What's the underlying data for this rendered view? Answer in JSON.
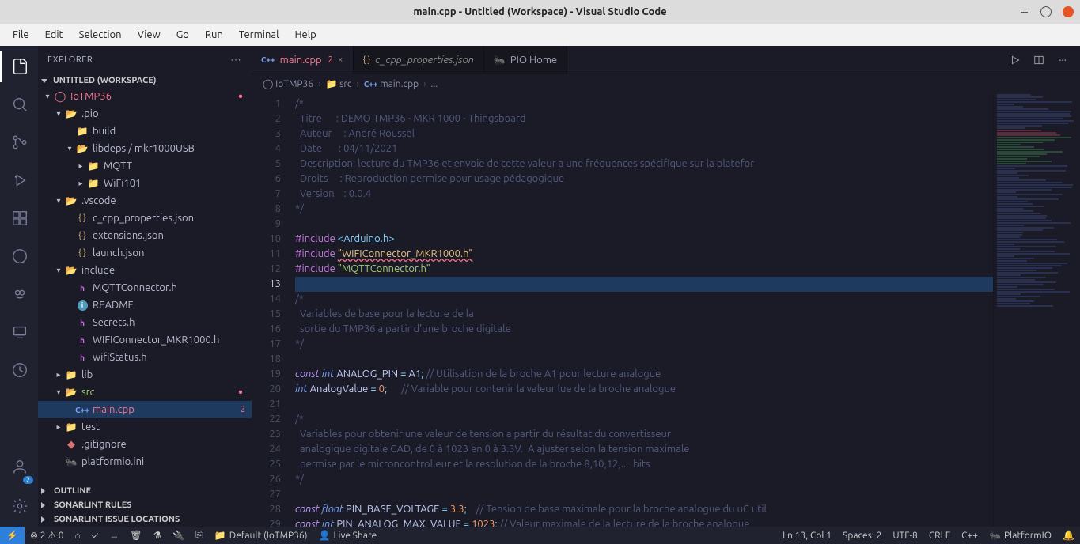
{
  "window": {
    "title": "main.cpp - Untitled (Workspace) - Visual Studio Code"
  },
  "menu": [
    "File",
    "Edit",
    "Selection",
    "View",
    "Go",
    "Run",
    "Terminal",
    "Help"
  ],
  "explorer": {
    "title": "EXPLORER",
    "workspace": "UNTITLED (WORKSPACE)",
    "outline": "OUTLINE",
    "sonar_rules": "SONARLINT RULES",
    "sonar_issues": "SONARLINT ISSUE LOCATIONS"
  },
  "tree": {
    "root": "IoTMP36",
    "pio": ".pio",
    "build": "build",
    "libdeps": "libdeps / mkr1000USB",
    "mqtt": "MQTT",
    "wifi101": "WiFi101",
    "vscode": ".vscode",
    "ccpp": "c_cpp_properties.json",
    "ext": "extensions.json",
    "launch": "launch.json",
    "include": "include",
    "mqttconn": "MQTTConnector.h",
    "readme": "README",
    "secrets": "Secrets.h",
    "wificonn": "WIFIConnector_MKR1000.h",
    "wifistatus": "wifiStatus.h",
    "lib": "lib",
    "src": "src",
    "maincpp": "main.cpp",
    "maincpp_err": "2",
    "test": "test",
    "gitignore": ".gitignore",
    "platformio": "platformio.ini"
  },
  "tabs": [
    {
      "name": "main.cpp",
      "badge": "2",
      "active": true,
      "icon": "cpp"
    },
    {
      "name": "c_cpp_properties.json",
      "italic": true,
      "icon": "json"
    },
    {
      "name": "PIO Home",
      "icon": "pio"
    }
  ],
  "breadcrumbs": [
    "IoTMP36",
    "src",
    "main.cpp",
    "..."
  ],
  "code": {
    "lines": [
      {
        "n": 1,
        "html": "<span class='c-com'>/*</span>"
      },
      {
        "n": 2,
        "html": "<span class='c-com'>  Titre      : DEMO TMP36 - MKR 1000 - Thingsboard</span>"
      },
      {
        "n": 3,
        "html": "<span class='c-com'>  Auteur     : André Roussel</span>"
      },
      {
        "n": 4,
        "html": "<span class='c-com'>  Date       : 04/11/2021</span>"
      },
      {
        "n": 5,
        "html": "<span class='c-com'>  Description: lecture du TMP36 et envoie de cette valeur a une fréquences spécifique sur la platefor</span>"
      },
      {
        "n": 6,
        "html": "<span class='c-com'>  Droits     : Reproduction permise pour usage pédagogique</span>"
      },
      {
        "n": 7,
        "html": "<span class='c-com'>  Version    : 0.0.4</span>"
      },
      {
        "n": 8,
        "html": "<span class='c-com'>*/</span>"
      },
      {
        "n": 9,
        "html": ""
      },
      {
        "n": 10,
        "html": "<span class='c-pre'>#include </span><span class='c-inc'>&lt;Arduino.h&gt;</span>"
      },
      {
        "n": 11,
        "html": "<span class='c-pre'>#include </span><span class='c-strw'>\"WIFIConnector_MKR1000.h\"</span>"
      },
      {
        "n": 12,
        "html": "<span class='c-pre'>#include </span><span class='c-str'>\"MQTTConnector.h\"</span>"
      },
      {
        "n": 13,
        "html": "",
        "hl": true
      },
      {
        "n": 14,
        "html": "<span class='c-com'>/*</span>"
      },
      {
        "n": 15,
        "html": "<span class='c-com'>  Variables de base pour la lecture de la </span>"
      },
      {
        "n": 16,
        "html": "<span class='c-com'>  sortie du TMP36 a partir d'une broche digitale</span>"
      },
      {
        "n": 17,
        "html": "<span class='c-com'>*/</span>"
      },
      {
        "n": 18,
        "html": ""
      },
      {
        "n": 19,
        "html": "<span class='c-kw'>const</span> <span class='c-type'>int</span> <span class='c-id'>ANALOG_PIN</span> <span class='c-op'>=</span> <span class='c-id'>A1</span><span class='c-op'>;</span> <span class='c-com'>// Utilisation de la broche A1 pour lecture analogue</span>"
      },
      {
        "n": 20,
        "html": "<span class='c-type'>int</span> <span class='c-id'>AnalogValue</span> <span class='c-op'>=</span> <span class='c-num'>0</span><span class='c-op'>;</span>      <span class='c-com'>// Variable pour contenir la valeur lue de la broche analogue</span>"
      },
      {
        "n": 21,
        "html": ""
      },
      {
        "n": 22,
        "html": "<span class='c-com'>/*</span>"
      },
      {
        "n": 23,
        "html": "<span class='c-com'>  Variables pour obtenir une valeur de tension a partir du résultat du convertisseur</span>"
      },
      {
        "n": 24,
        "html": "<span class='c-com'>  analogique digitale CAD, de 0 à 1023 en 0 à 3.3V.  A ajuster selon la tension maximale</span>"
      },
      {
        "n": 25,
        "html": "<span class='c-com'>  permise par le microncontrolleur et la resolution de la broche 8,10,12,...  bits</span>"
      },
      {
        "n": 26,
        "html": "<span class='c-com'>*/</span>"
      },
      {
        "n": 27,
        "html": ""
      },
      {
        "n": 28,
        "html": "<span class='c-kw'>const</span> <span class='c-type'>float</span> <span class='c-id'>PIN_BASE_VOLTAGE</span> <span class='c-op'>=</span> <span class='c-num'>3.3</span><span class='c-op'>;</span>    <span class='c-com'>// Tension de base maximale pour la broche analogue du uC util</span>"
      },
      {
        "n": 29,
        "html": "<span class='c-kw'>const</span> <span class='c-type'>int</span> <span class='c-id'>PIN_ANALOG_MAX_VALUE</span> <span class='c-op'>=</span> <span class='c-num'>1023</span><span class='c-op'>;</span> <span class='c-com'>// Valeur maximale de la lecture de la broche analogue</span>"
      }
    ]
  },
  "status": {
    "errwarn": "⊗ 2 ⚠ 0",
    "default": "Default (IoTMP36)",
    "liveshare": "Live Share",
    "lncol": "Ln 13, Col 1",
    "spaces": "Spaces: 2",
    "enc": "UTF-8",
    "eol": "CRLF",
    "lang": "C++",
    "pio": "PlatformIO"
  }
}
